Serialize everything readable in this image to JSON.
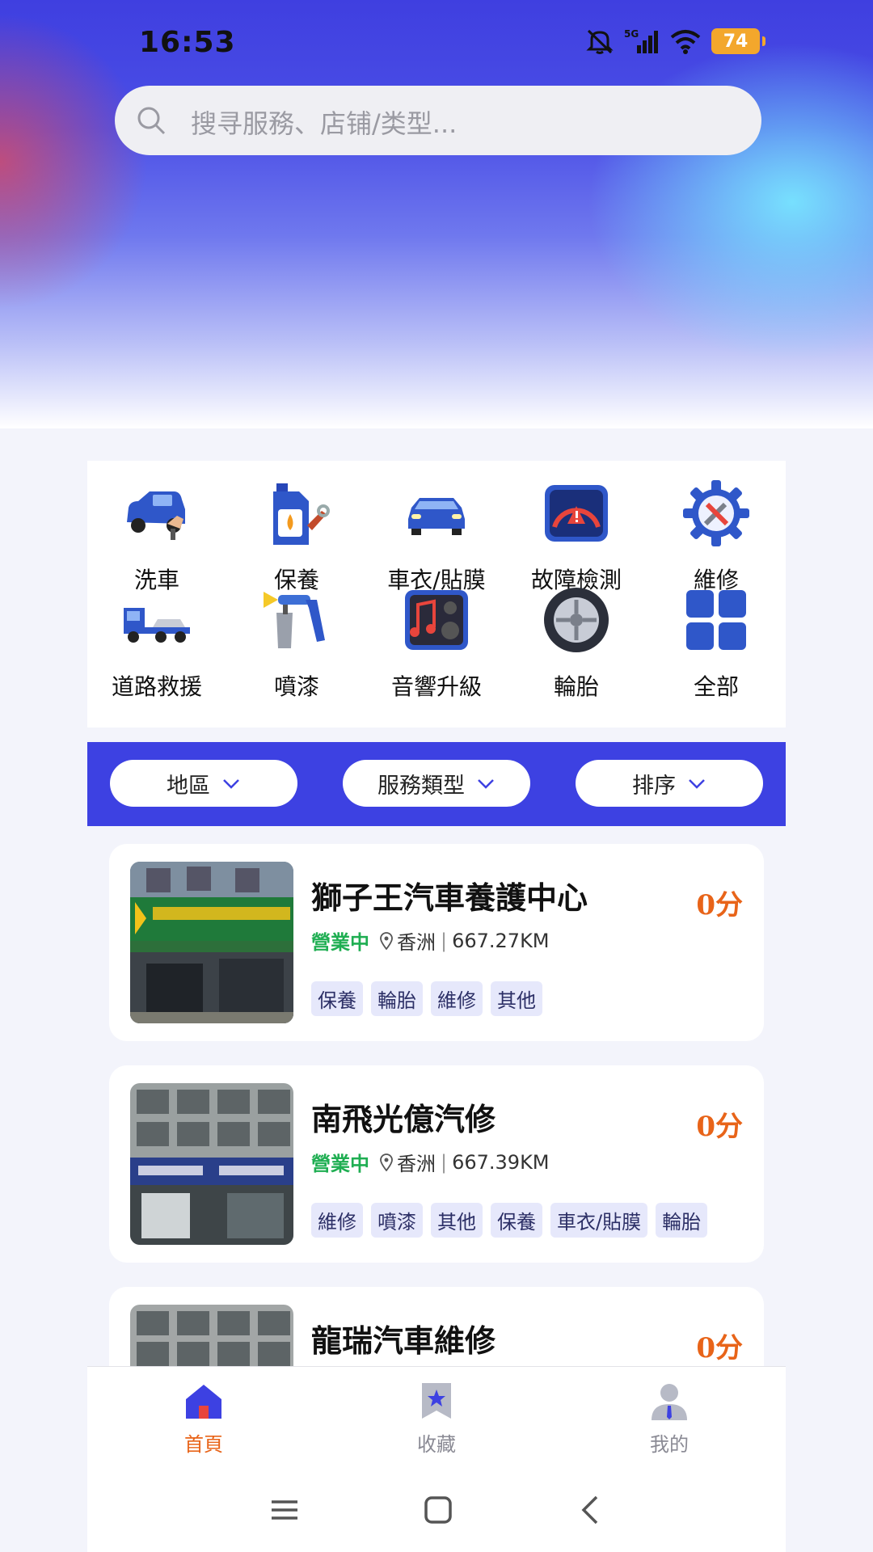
{
  "status_bar": {
    "time": "16:53",
    "network": "5G",
    "battery": "74"
  },
  "search": {
    "placeholder": "搜寻服務、店铺/类型..."
  },
  "categories": [
    {
      "label": "洗車",
      "icon": "car-wash-icon"
    },
    {
      "label": "保養",
      "icon": "oil-can-icon"
    },
    {
      "label": "車衣/貼膜",
      "icon": "car-film-icon"
    },
    {
      "label": "故障檢測",
      "icon": "diagnostic-gauge-icon"
    },
    {
      "label": "維修",
      "icon": "repair-gear-icon"
    },
    {
      "label": "道路救援",
      "icon": "tow-truck-icon"
    },
    {
      "label": "噴漆",
      "icon": "spray-gun-icon"
    },
    {
      "label": "音響升級",
      "icon": "audio-icon"
    },
    {
      "label": "輪胎",
      "icon": "tire-icon"
    },
    {
      "label": "全部",
      "icon": "all-grid-icon"
    }
  ],
  "filters": {
    "region": "地區",
    "service_type": "服務類型",
    "sort": "排序"
  },
  "shops": [
    {
      "name": "獅子王汽車養護中心",
      "status": "營業中",
      "location": "香洲",
      "distance": "667.27KM",
      "score": "0分",
      "tags": [
        "保養",
        "輪胎",
        "維修",
        "其他"
      ]
    },
    {
      "name": "南飛光億汽修",
      "status": "營業中",
      "location": "香洲",
      "distance": "667.39KM",
      "score": "0分",
      "tags": [
        "維修",
        "噴漆",
        "其他",
        "保養",
        "車衣/貼膜",
        "輪胎"
      ]
    },
    {
      "name": "龍瑞汽車維修",
      "score": "0分"
    }
  ],
  "tabbar": {
    "home": "首頁",
    "favorites": "收藏",
    "mine": "我的"
  },
  "colors": {
    "brand": "#3d41e2",
    "accent": "#e86419",
    "open": "#1fae52",
    "tag_bg": "#e6e8fb"
  }
}
